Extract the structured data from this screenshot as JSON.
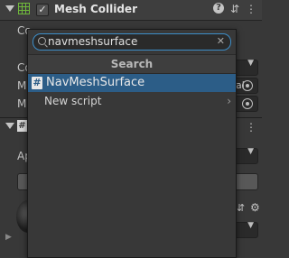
{
  "inspector": {
    "component_title": "Mesh Collider",
    "enabled_check": "✓",
    "help_glyph": "?",
    "presets_glyph": "⇵",
    "menu_glyph": "⋮",
    "row_labels": [
      "Co",
      "Co",
      "M",
      "M",
      "Ap"
    ],
    "partial_text_right": "al",
    "second_header_icon": "#"
  },
  "popup": {
    "search": {
      "value": "navmeshsurface",
      "placeholder": "",
      "clear_glyph": "✕"
    },
    "header_label": "Search",
    "results": [
      {
        "label": "NavMeshSurface",
        "icon": "#"
      }
    ],
    "new_script_label": "New script",
    "new_script_chevron": "›"
  },
  "colors": {
    "selection": "#2c5d87",
    "focus_border": "#3d8ec9",
    "component_icon": "#6fb83b"
  }
}
